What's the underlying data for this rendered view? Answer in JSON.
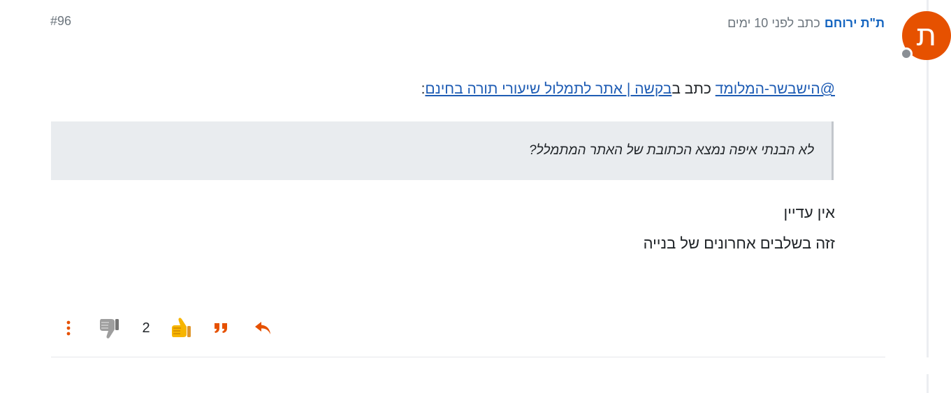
{
  "post": {
    "avatar_letter": "ת",
    "author": "ת\"ת ירוחם",
    "meta": "כתב לפני 10 ימים",
    "index": "#96"
  },
  "quote_intro": {
    "mention": "@הישבשר-המלומד",
    "written_in": "כתב ב",
    "topic": "בקשה | אתר לתמלול שיעורי תורה בחינם",
    "suffix": ":"
  },
  "blockquote": {
    "text": "לא הבנתי איפה נמצא הכתובת של האתר המתמלל?"
  },
  "body": {
    "line1": "אין עדיין",
    "line2": "זזה בשלבים אחרונים של בנייה"
  },
  "actions": {
    "upvote_count": "2",
    "icons": [
      "reply-icon",
      "quote-icon",
      "thumbs-up-icon",
      "thumbs-down-icon",
      "more-options-icon"
    ]
  },
  "colors": {
    "accent": "#e65100",
    "link": "#1565c0",
    "avatar_bg": "#e65100",
    "status_offline": "#8a8f95",
    "quote_bg": "#e9ecef"
  }
}
